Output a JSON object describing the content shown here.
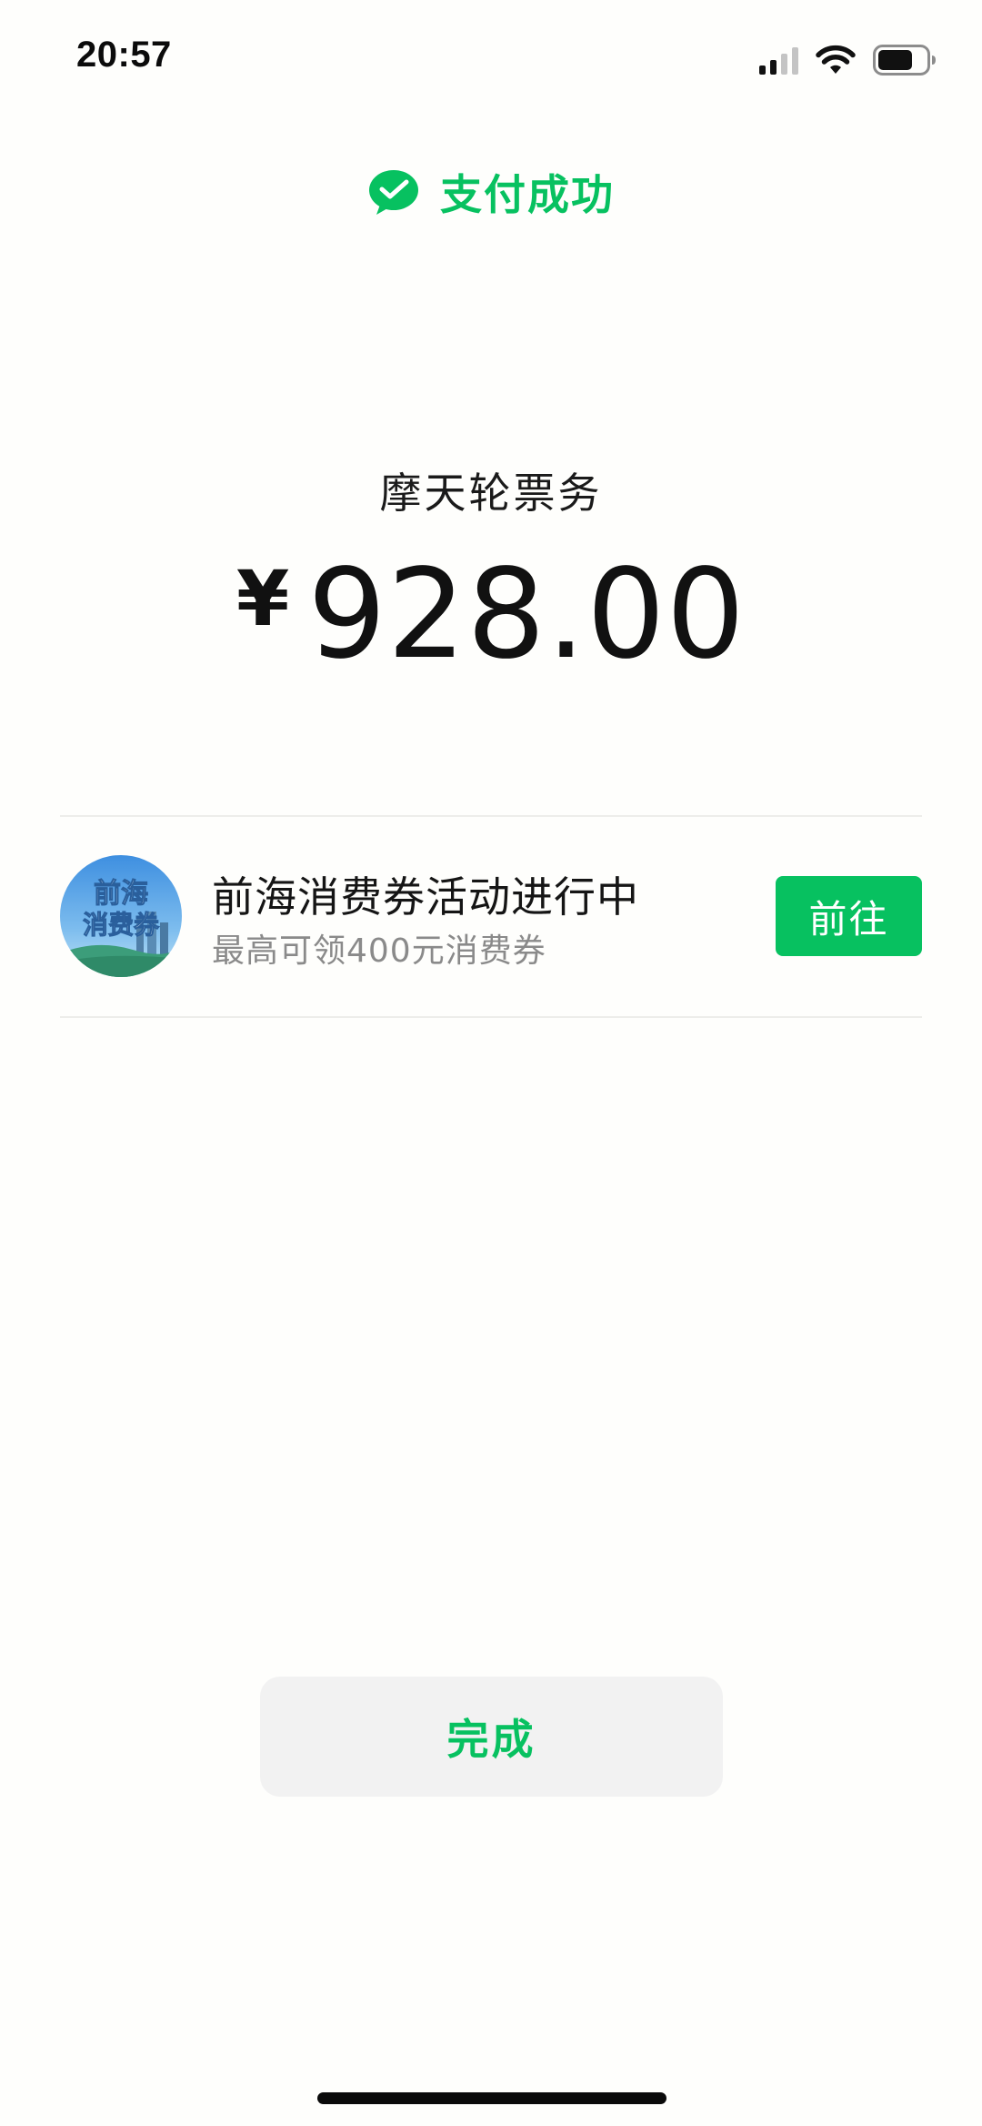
{
  "status_bar": {
    "time": "20:57",
    "icons": [
      "signal-icon",
      "wifi-icon",
      "battery-icon"
    ]
  },
  "header": {
    "title": "支付成功",
    "icon": "wechat-pay-icon",
    "accent_color": "#07c160"
  },
  "payment": {
    "merchant": "摩天轮票务",
    "currency_symbol": "¥",
    "amount": "928.00"
  },
  "promo": {
    "logo_text_line1": "前海",
    "logo_text_line2": "消费券",
    "title": "前海消费券活动进行中",
    "subtitle": "最高可领400元消费券",
    "button_label": "前往",
    "button_color": "#07c160"
  },
  "footer": {
    "done_label": "完成"
  }
}
